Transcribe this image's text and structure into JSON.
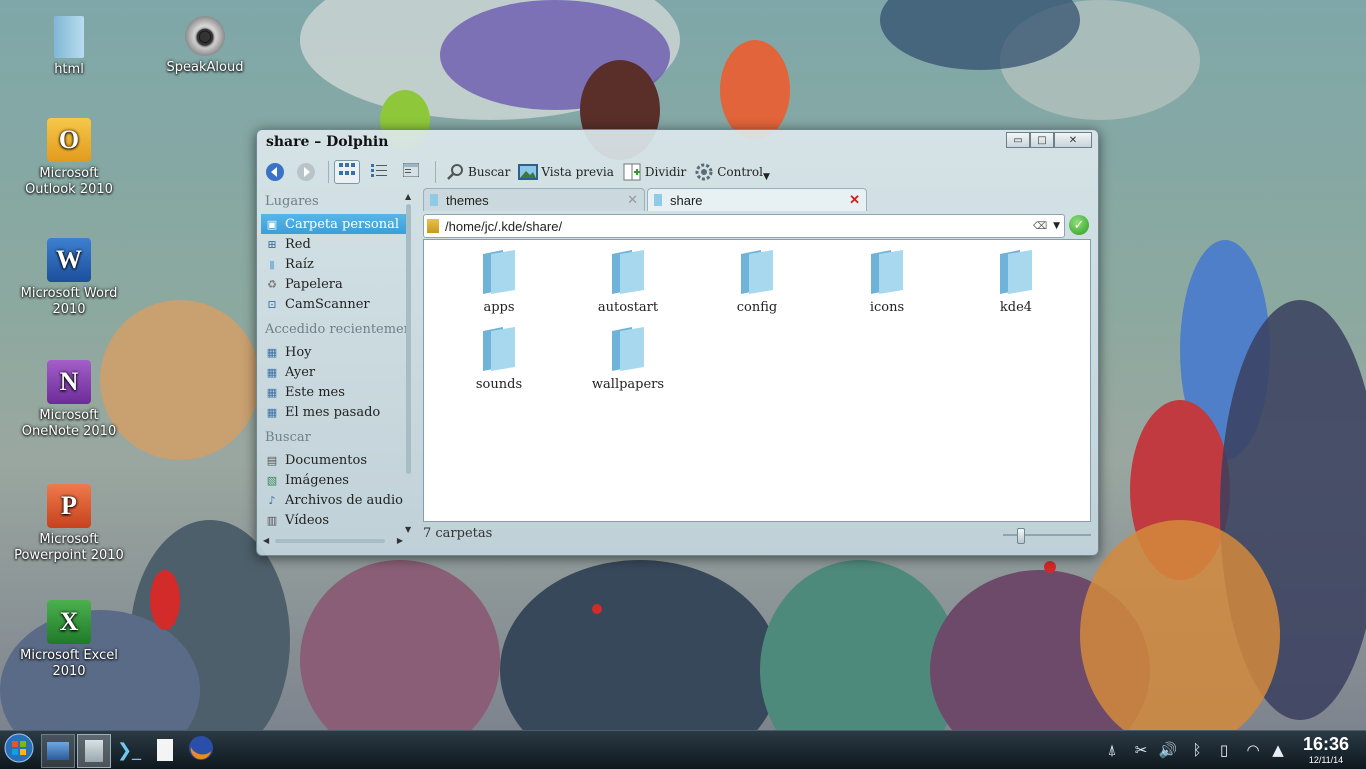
{
  "desktop": {
    "icons": [
      {
        "label": "html",
        "icon": "folder-icon"
      },
      {
        "label": "SpeakAloud",
        "icon": "speaker-icon"
      },
      {
        "label": "Microsoft Outlook 2010",
        "icon": "outlook-icon",
        "glyph": "O"
      },
      {
        "label": "Microsoft Word 2010",
        "icon": "word-icon",
        "glyph": "W"
      },
      {
        "label": "Microsoft OneNote 2010",
        "icon": "onenote-icon",
        "glyph": "N"
      },
      {
        "label": "Microsoft Powerpoint 2010",
        "icon": "powerpoint-icon",
        "glyph": "P"
      },
      {
        "label": "Microsoft Excel 2010",
        "icon": "excel-icon",
        "glyph": "X"
      }
    ]
  },
  "window": {
    "title": "share – Dolphin",
    "controls": {
      "minimize": "▭",
      "maximize": "□",
      "close": "✕"
    },
    "toolbar": {
      "search_label": "Buscar",
      "preview_label": "Vista previa",
      "split_label": "Dividir",
      "control_label": "Control"
    },
    "places": {
      "section_places": "Lugares",
      "places_items": [
        "Carpeta personal",
        "Red",
        "Raíz",
        "Papelera",
        "CamScanner"
      ],
      "section_recent": "Accedido recientemente",
      "recent_items": [
        "Hoy",
        "Ayer",
        "Este mes",
        "El mes pasado"
      ],
      "section_search": "Buscar",
      "search_items": [
        "Documentos",
        "Imágenes",
        "Archivos de audio",
        "Vídeos"
      ]
    },
    "tabs": [
      {
        "label": "themes",
        "active": false
      },
      {
        "label": "share",
        "active": true
      }
    ],
    "location": "/home/jc/.kde/share/",
    "folders": [
      "apps",
      "autostart",
      "config",
      "icons",
      "kde4",
      "sounds",
      "wallpapers"
    ],
    "status": "7 carpetas"
  },
  "taskbar": {
    "clock_time": "16:36",
    "clock_date": "12/11/14"
  },
  "colors": {
    "selection": "#3a9fd8",
    "folder": "#8fcbe6",
    "taskbar": "#16222b"
  }
}
